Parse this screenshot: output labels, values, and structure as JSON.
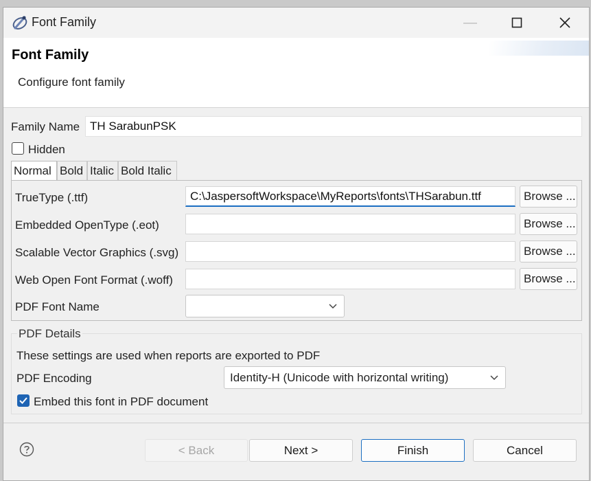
{
  "window": {
    "title": "Font Family"
  },
  "header": {
    "title": "Font Family",
    "description": "Configure font family"
  },
  "form": {
    "family_name_label": "Family Name",
    "family_name_value": "TH SarabunPSK",
    "hidden_label": "Hidden",
    "hidden_checked": false
  },
  "tabs": [
    {
      "label": "Normal",
      "active": true
    },
    {
      "label": "Bold"
    },
    {
      "label": "Italic"
    },
    {
      "label": "Bold Italic"
    }
  ],
  "font_files": {
    "truetype_label": "TrueType (.ttf)",
    "truetype_value": "C:\\JaspersoftWorkspace\\MyReports\\fonts\\THSarabun.ttf",
    "eot_label": "Embedded OpenType (.eot)",
    "eot_value": "",
    "svg_label": "Scalable Vector Graphics (.svg)",
    "svg_value": "",
    "woff_label": "Web Open Font Format (.woff)",
    "woff_value": "",
    "browse_label": "Browse ...",
    "pdf_font_name_label": "PDF Font Name",
    "pdf_font_name_value": ""
  },
  "pdf_details": {
    "group_title": "PDF Details",
    "info": "These settings are used when reports are exported to PDF",
    "encoding_label": "PDF Encoding",
    "encoding_value": "Identity-H (Unicode with horizontal writing)",
    "embed_label": "Embed this font in PDF document",
    "embed_checked": true
  },
  "buttons": {
    "back": "< Back",
    "next": "Next >",
    "finish": "Finish",
    "cancel": "Cancel"
  },
  "colors": {
    "accent": "#1e64b4"
  }
}
